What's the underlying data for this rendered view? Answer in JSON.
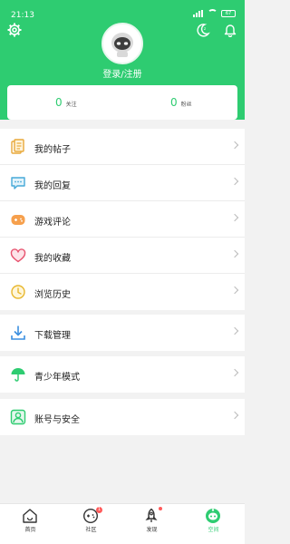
{
  "status_bar": {
    "time": "21:13",
    "battery": "67"
  },
  "header": {
    "login_text": "登录/注册"
  },
  "stats": [
    {
      "count": "0",
      "label": "关注"
    },
    {
      "count": "0",
      "label": "粉丝"
    }
  ],
  "menu": {
    "group1": [
      {
        "label": "我的帖子",
        "icon": "posts-icon"
      },
      {
        "label": "我的回复",
        "icon": "reply-icon"
      },
      {
        "label": "游戏评论",
        "icon": "game-review-icon"
      },
      {
        "label": "我的收藏",
        "icon": "heart-icon"
      },
      {
        "label": "浏览历史",
        "icon": "history-icon"
      }
    ],
    "group2": [
      {
        "label": "下载管理",
        "icon": "download-icon"
      }
    ],
    "group3": [
      {
        "label": "青少年模式",
        "icon": "umbrella-icon"
      }
    ],
    "group4": [
      {
        "label": "账号与安全",
        "icon": "account-icon"
      }
    ]
  },
  "tabbar": {
    "items": [
      {
        "label": "首页",
        "icon": "home-icon"
      },
      {
        "label": "社区",
        "icon": "community-icon",
        "badge": "1"
      },
      {
        "label": "发现",
        "icon": "rocket-icon"
      },
      {
        "label": "空间",
        "icon": "space-icon"
      }
    ],
    "active": "空间"
  },
  "colors": {
    "accent": "#2ecc71",
    "badge": "#ff5a5a",
    "background": "#f2f2f2"
  }
}
